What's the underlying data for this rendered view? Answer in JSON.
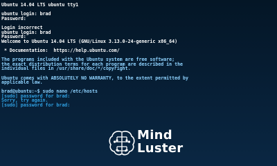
{
  "terminal": {
    "lines": [
      {
        "text": "Ubuntu 14.04 LTS ubuntu tty1",
        "style": "white"
      },
      {
        "text": "",
        "style": "blank"
      },
      {
        "text": "ubuntu login: brad",
        "style": "white"
      },
      {
        "text": "Password:",
        "style": "white"
      },
      {
        "text": "",
        "style": "blank"
      },
      {
        "text": "Login incorrect",
        "style": "white"
      },
      {
        "text": "ubuntu login: brad",
        "style": "white"
      },
      {
        "text": "Password:",
        "style": "white"
      },
      {
        "text": "Welcome to Ubuntu 14.04 LTS (GNU/Linux 3.13.0-24-generic x86_64)",
        "style": "white"
      },
      {
        "text": "",
        "style": "blank"
      },
      {
        "text": " * Documentation:  https://help.ubuntu.com/",
        "style": "white"
      },
      {
        "text": "",
        "style": "blank"
      },
      {
        "text": "The programs included with the Ubuntu system are free software;",
        "style": "cyan"
      },
      {
        "text": "the exact distribution terms for each program are described in the",
        "style": "cyan"
      },
      {
        "text": "individual files in /usr/share/doc/*/copyright.",
        "style": "cyan"
      },
      {
        "text": "",
        "style": "blank"
      },
      {
        "text": "Ubuntu comes with ABSOLUTELY NO WARRANTY, to the extent permitted by",
        "style": "cyan"
      },
      {
        "text": "applicable law.",
        "style": "cyan"
      },
      {
        "text": "",
        "style": "blank"
      },
      {
        "text": "brad@ubuntu:~$ sudo nano /etc/hosts",
        "style": "cyan"
      },
      {
        "text": "[sudo] password for brad:",
        "style": "blue"
      },
      {
        "text": "Sorry, try again.",
        "style": "blue"
      },
      {
        "text": "[sudo] password for brad:",
        "style": "blue"
      }
    ]
  },
  "watermark": {
    "word1": "Mind",
    "word2": "Luster",
    "icon": "brain-icon",
    "colors": {
      "text": "#ffffff",
      "icon": "#ffffff"
    }
  },
  "colors": {
    "background": "#061a2c",
    "text_primary": "#ffffff",
    "text_cyan": "#8fd3ff",
    "text_blue": "#2f9fe0"
  }
}
